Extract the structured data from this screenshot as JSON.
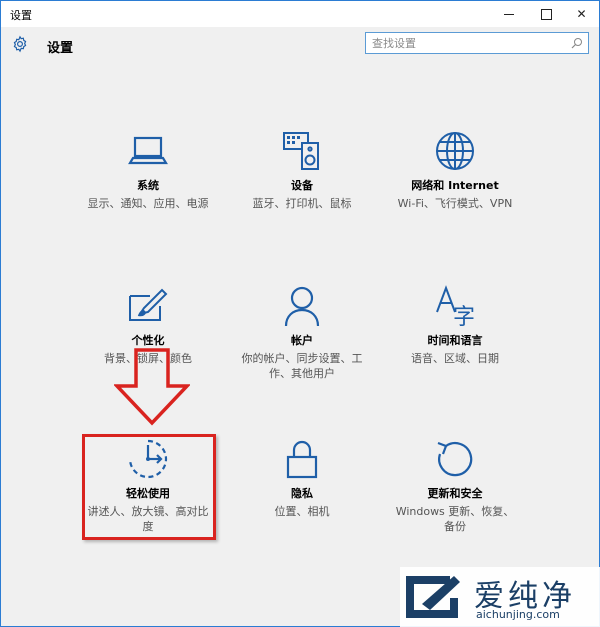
{
  "window": {
    "title": "设置"
  },
  "header": {
    "title": "设置"
  },
  "search": {
    "placeholder": "查找设置"
  },
  "tiles": [
    {
      "icon": "laptop-icon",
      "title": "系统",
      "desc": "显示、通知、应用、电源"
    },
    {
      "icon": "keyboard-speaker-icon",
      "title": "设备",
      "desc": "蓝牙、打印机、鼠标"
    },
    {
      "icon": "globe-icon",
      "title": "网络和 Internet",
      "desc": "Wi-Fi、飞行模式、VPN"
    },
    {
      "icon": "paint-brush-icon",
      "title": "个性化",
      "desc": "背景、锁屏、颜色"
    },
    {
      "icon": "person-icon",
      "title": "帐户",
      "desc": "你的帐户、同步设置、工作、其他用户"
    },
    {
      "icon": "language-icon",
      "title": "时间和语言",
      "desc": "语音、区域、日期"
    },
    {
      "icon": "ease-of-access-icon",
      "title": "轻松使用",
      "desc": "讲述人、放大镜、高对比度"
    },
    {
      "icon": "lock-icon",
      "title": "隐私",
      "desc": "位置、相机"
    },
    {
      "icon": "refresh-icon",
      "title": "更新和安全",
      "desc": "Windows 更新、恢复、备份"
    }
  ],
  "annotation": {
    "arrow_color": "#d9231f",
    "highlight_color": "#d9231f"
  },
  "watermark": {
    "text": "爱纯净",
    "url": "aichunjing.com"
  },
  "colors": {
    "accent": "#1f5fa8",
    "window_border": "#2b7cd3",
    "background": "#f0f0f0"
  }
}
